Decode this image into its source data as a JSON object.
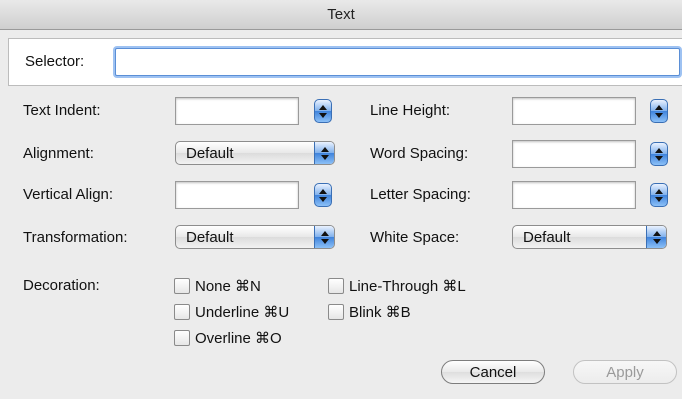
{
  "window": {
    "title": "Text"
  },
  "selector": {
    "label": "Selector:",
    "value": ""
  },
  "fields": {
    "text_indent": {
      "label": "Text Indent:",
      "value": ""
    },
    "line_height": {
      "label": "Line Height:",
      "value": ""
    },
    "alignment": {
      "label": "Alignment:",
      "selected": "Default"
    },
    "word_spacing": {
      "label": "Word Spacing:",
      "value": ""
    },
    "vertical_align": {
      "label": "Vertical Align:",
      "value": ""
    },
    "letter_spacing": {
      "label": "Letter Spacing:",
      "value": ""
    },
    "transformation": {
      "label": "Transformation:",
      "selected": "Default"
    },
    "white_space": {
      "label": "White Space:",
      "selected": "Default"
    }
  },
  "decoration": {
    "label": "Decoration:",
    "options": [
      {
        "label": "None ⌘N",
        "checked": false
      },
      {
        "label": "Line-Through ⌘L",
        "checked": false
      },
      {
        "label": "Underline ⌘U",
        "checked": false
      },
      {
        "label": "Blink ⌘B",
        "checked": false
      },
      {
        "label": "Overline ⌘O",
        "checked": false
      }
    ]
  },
  "buttons": {
    "cancel": "Cancel",
    "apply": "Apply"
  },
  "colors": {
    "accent": "#3f83dc",
    "focus_ring": "#9ec2f2"
  }
}
